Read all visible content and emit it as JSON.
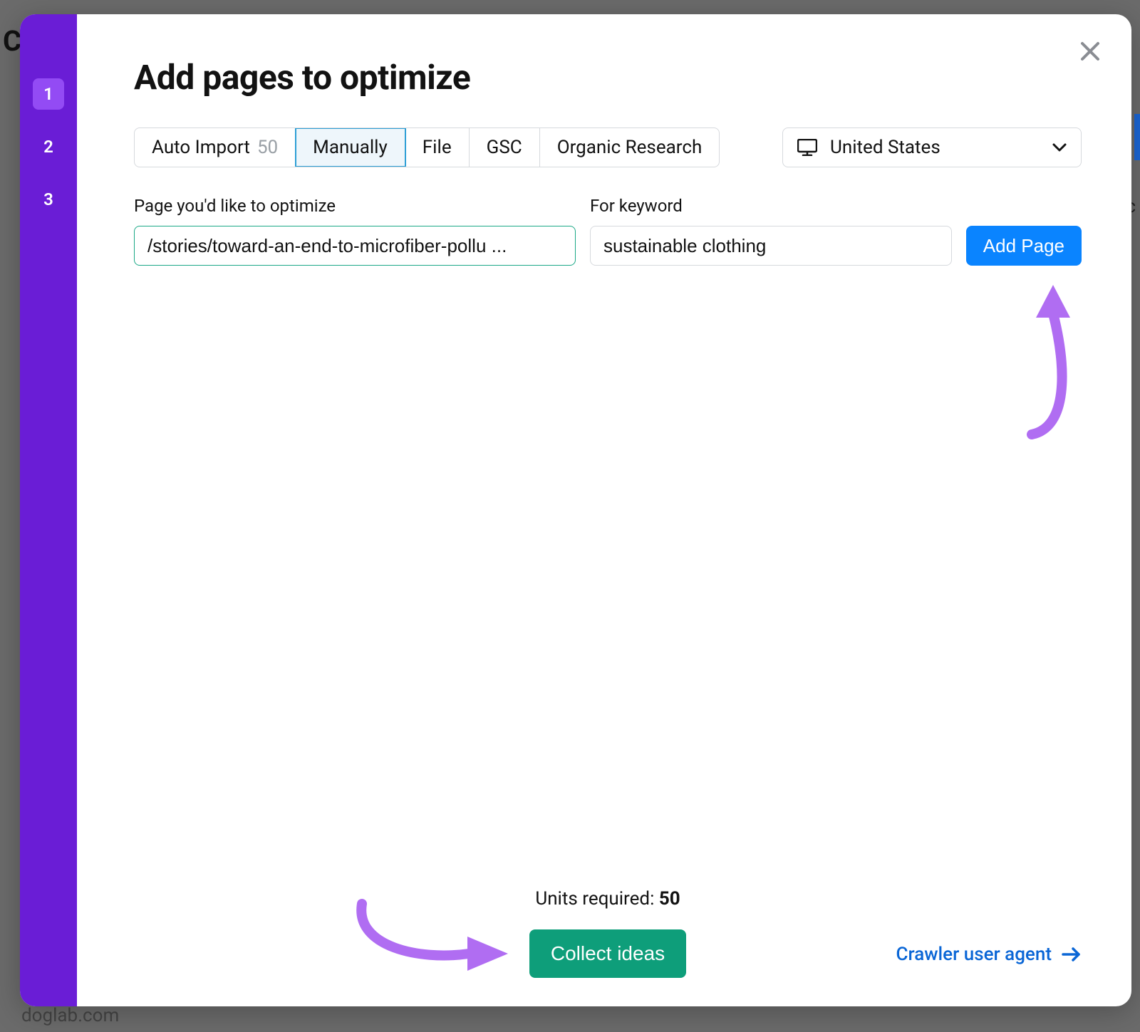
{
  "background": {
    "hint_letter": "C",
    "hint_url_fragment": "doglab.com",
    "hint_right_fragment": "ec"
  },
  "modal": {
    "title": "Add pages to optimize",
    "close_label": "Close",
    "steps": [
      "1",
      "2",
      "3"
    ],
    "active_step_index": 0,
    "tabs": {
      "auto_import": {
        "label": "Auto Import",
        "count": "50"
      },
      "manually": {
        "label": "Manually"
      },
      "file": {
        "label": "File"
      },
      "gsc": {
        "label": "GSC"
      },
      "organic": {
        "label": "Organic Research"
      }
    },
    "selected_tab": "manually",
    "country": {
      "label": "United States"
    },
    "form": {
      "page_label": "Page you'd like to optimize",
      "page_value": "/stories/toward-an-end-to-microfiber-pollu ...",
      "keyword_label": "For keyword",
      "keyword_value": "sustainable clothing",
      "add_button": "Add Page"
    },
    "footer": {
      "units_prefix": "Units required: ",
      "units_value": "50",
      "collect_button": "Collect ideas",
      "crawler_link": "Crawler user agent"
    },
    "colors": {
      "purple_rail": "#6a1dd6",
      "step_active": "#934bf4",
      "primary_blue": "#0a84ff",
      "link_blue": "#0a66d6",
      "collect_green": "#0e9e7a",
      "page_input_border": "#1aa886",
      "annotation_purple": "#b06df2"
    }
  }
}
